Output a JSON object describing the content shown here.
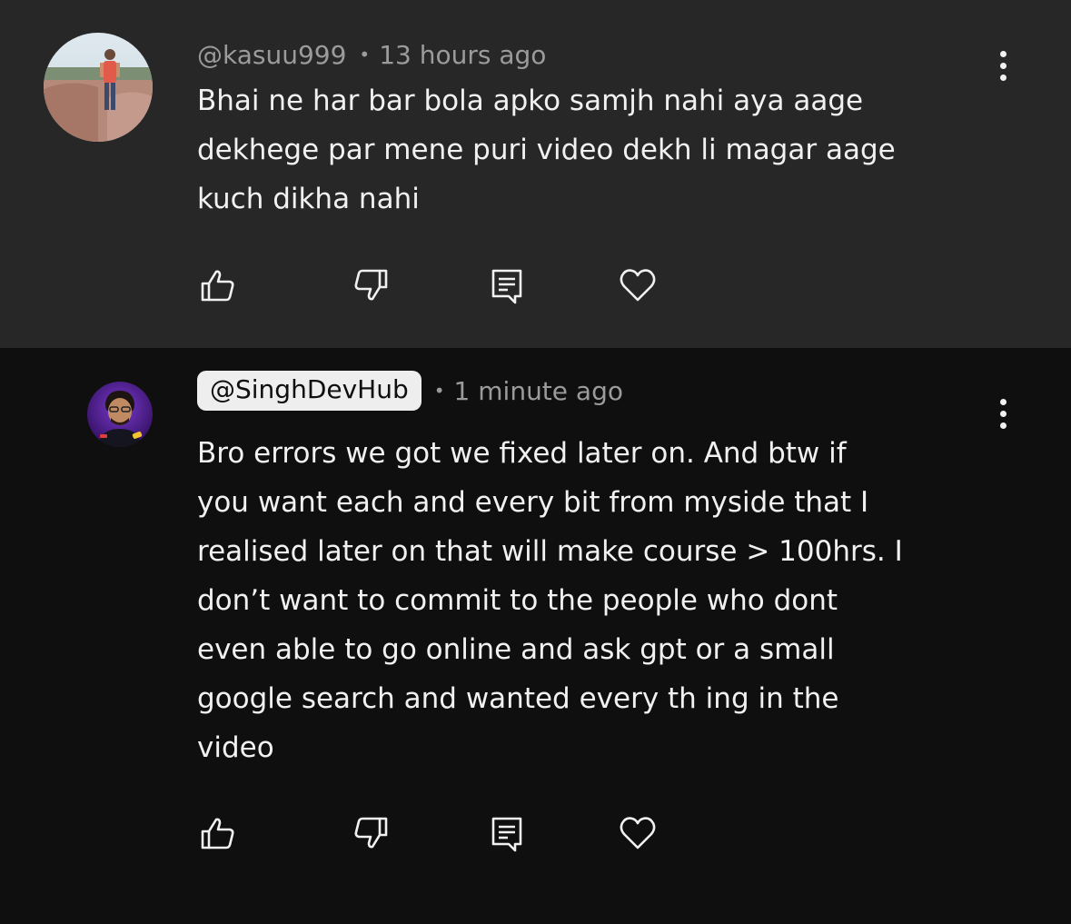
{
  "comments": [
    {
      "handle": "@kasuu999",
      "time": "13 hours ago",
      "lines": [
        "Bhai ne har bar  bola apko samjh nahi aya aage",
        "dekhege par mene puri video dekh li magar aage",
        "kuch dikha nahi"
      ],
      "handle_highlighted": false,
      "avatar_icon": "user-photo-avatar"
    },
    {
      "handle": "@SinghDevHub",
      "time": "1 minute ago",
      "lines": [
        "Bro errors we got we fixed later on. And btw if",
        "you want each and every bit from myside that I",
        "realised later on that will make course > 100hrs. I",
        "don’t want to commit to the people who dont",
        "even able to go online and ask gpt or a small",
        "google search and wanted every th ing in the",
        "video"
      ],
      "handle_highlighted": true,
      "avatar_icon": "creator-avatar"
    }
  ],
  "separator": "•",
  "icons": {
    "like": "thumbs-up-icon",
    "dislike": "thumbs-down-icon",
    "reply": "reply-comment-icon",
    "heart": "heart-icon",
    "more": "more-vertical-icon"
  },
  "colors": {
    "top_bg": "#272727",
    "bottom_bg": "#0f0f0f",
    "text": "#f1f1f1",
    "meta": "#9b9b9b",
    "chip_bg": "#eeeeee"
  }
}
